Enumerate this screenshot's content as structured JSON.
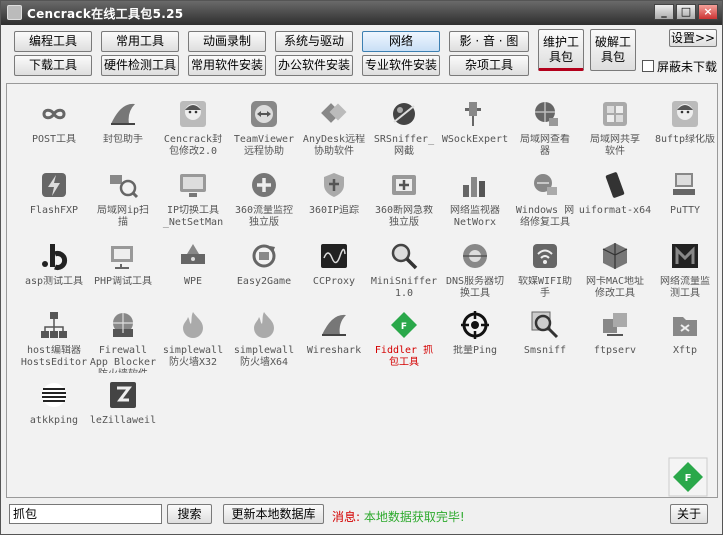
{
  "window": {
    "title": "Cencrack在线工具包5.25"
  },
  "title_buttons": {
    "minimize": "_",
    "maximize": "□",
    "close": "×"
  },
  "toolbar": {
    "row1": [
      "编程工具",
      "常用工具",
      "动画录制",
      "系统与驱动",
      "网络",
      "影 · 音 · 图"
    ],
    "row2": [
      "下载工具",
      "硬件检测工具",
      "常用软件安装",
      "办公软件安装",
      "专业软件安装",
      "杂项工具"
    ],
    "big": [
      "维护工\n具包",
      "破解工\n具包"
    ],
    "settings": "设置>>",
    "hide_checkbox": "屏蔽未下载"
  },
  "tools": [
    {
      "label": "POST工具",
      "icon": "infinity-icon"
    },
    {
      "label": "封包助手",
      "icon": "shark-fin-icon"
    },
    {
      "label": "Cencrack封\n包修改2.0",
      "icon": "anime-avatar-icon"
    },
    {
      "label": "TeamViewer\n远程协助",
      "icon": "teamviewer-icon"
    },
    {
      "label": "AnyDesk远程\n协助软件",
      "icon": "anydesk-icon"
    },
    {
      "label": "SRSniffer_\n网截",
      "icon": "satellite-icon"
    },
    {
      "label": "WSockExpert",
      "icon": "socket-icon"
    },
    {
      "label": "局域网查看\n器",
      "icon": "globe-network-icon"
    },
    {
      "label": "局域网共享\n软件",
      "icon": "windows-share-icon"
    },
    {
      "label": "8uftp绿化版",
      "icon": "anime-avatar-icon"
    },
    {
      "label": "FlashFXP",
      "icon": "flash-icon"
    },
    {
      "label": "局域网ip扫\n描",
      "icon": "network-scan-icon"
    },
    {
      "label": "IP切换工具\n_NetSetMan",
      "icon": "monitor-icon"
    },
    {
      "label": "360流量监控\n独立版",
      "icon": "plus-circle-icon"
    },
    {
      "label": "360IP追踪",
      "icon": "shield-icon"
    },
    {
      "label": "360断网急救\n独立版",
      "icon": "first-aid-icon"
    },
    {
      "label": "网络监视器\nNetWorx",
      "icon": "bar-chart-icon"
    },
    {
      "label": "Windows 网\n络修复工具",
      "icon": "network-repair-icon"
    },
    {
      "label": "uiformat-x64",
      "icon": "usb-drive-icon"
    },
    {
      "label": "PuTTY",
      "icon": "putty-icon"
    },
    {
      "label": "asp测试工具",
      "icon": "dotb-icon"
    },
    {
      "label": "PHP调试工具",
      "icon": "php-debug-icon"
    },
    {
      "label": "WPE",
      "icon": "wpe-icon"
    },
    {
      "label": "Easy2Game",
      "icon": "refresh-icon"
    },
    {
      "label": "CCProxy",
      "icon": "oscilloscope-icon"
    },
    {
      "label": "MiniSniffer\n1.0",
      "icon": "magnifier-icon"
    },
    {
      "label": "DNS服务器切\n换工具",
      "icon": "dns-icon"
    },
    {
      "label": "软媒WIFI助\n手",
      "icon": "wifi-icon"
    },
    {
      "label": "网卡MAC地址\n修改工具",
      "icon": "cube-icon"
    },
    {
      "label": "网络流量监\n测工具",
      "icon": "network-meter-icon"
    },
    {
      "label": "host编辑器\nHostsEditor",
      "icon": "host-network-icon"
    },
    {
      "label": "Firewall\nApp Blocker\n防火墙软件",
      "icon": "firewall-globe-icon"
    },
    {
      "label": "simplewall\n防火墙X32",
      "icon": "flame-icon"
    },
    {
      "label": "simplewall\n防火墙X64",
      "icon": "flame-icon"
    },
    {
      "label": "Wireshark",
      "icon": "shark-fin-icon"
    },
    {
      "label": "Fiddler 抓\n包工具",
      "icon": "fiddler-icon",
      "highlight": true
    },
    {
      "label": "批量Ping",
      "icon": "crosshair-icon"
    },
    {
      "label": "Smsniff",
      "icon": "sniff-magnifier-icon"
    },
    {
      "label": "ftpserv",
      "icon": "ftp-server-icon"
    },
    {
      "label": "Xftp",
      "icon": "xftp-icon"
    },
    {
      "label": "atkkping",
      "icon": "stripes-globe-icon"
    },
    {
      "label": "leZillaweil",
      "icon": "filezilla-icon"
    }
  ],
  "bottom": {
    "search_value": "抓包",
    "search_button": "搜索",
    "update_button": "更新本地数据库",
    "message_key": "消息:",
    "message_value": " 本地数据获取完毕!",
    "about_button": "关于"
  },
  "colors": {
    "accent_red": "#d40000",
    "status_green": "#2eaa2e",
    "fiddler_green": "#2aa84a"
  }
}
